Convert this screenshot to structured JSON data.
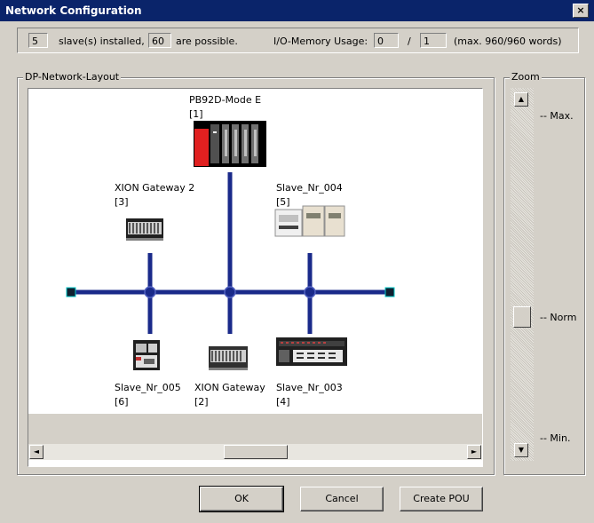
{
  "window": {
    "title": "Network Configuration",
    "close_glyph": "×"
  },
  "status": {
    "slaves_installed": "5",
    "slaves_installed_label": "slave(s) installed,",
    "possible_count": "60",
    "possible_label": "are possible.",
    "io_label": "I/O-Memory Usage:",
    "io_used": "0",
    "io_sep": "/",
    "io_total": "1",
    "io_max": "(max. 960/960 words)"
  },
  "network": {
    "group_label": "DP-Network-Layout",
    "master": {
      "name": "PB92D-Mode E",
      "index": "[1]"
    },
    "slaves": [
      {
        "name": "XION Gateway 2",
        "index": "[3]"
      },
      {
        "name": "Slave_Nr_004",
        "index": "[5]"
      },
      {
        "name": "Slave_Nr_005",
        "index": "[6]"
      },
      {
        "name": "XION Gateway",
        "index": "[2]"
      },
      {
        "name": "Slave_Nr_003",
        "index": "[4]"
      }
    ],
    "scroll_left": "◄",
    "scroll_right": "►"
  },
  "zoom": {
    "group_label": "Zoom",
    "max_label": "-- Max.",
    "norm_label": "-- Norm",
    "min_label": "-- Min.",
    "up": "▲",
    "down": "▼"
  },
  "buttons": {
    "ok": "OK",
    "cancel": "Cancel",
    "create_pou": "Create POU"
  },
  "colors": {
    "title_bar": "#0a246a",
    "bus": "#1a2a8a",
    "face": "#d4d0c8",
    "red_module": "#e02020"
  }
}
